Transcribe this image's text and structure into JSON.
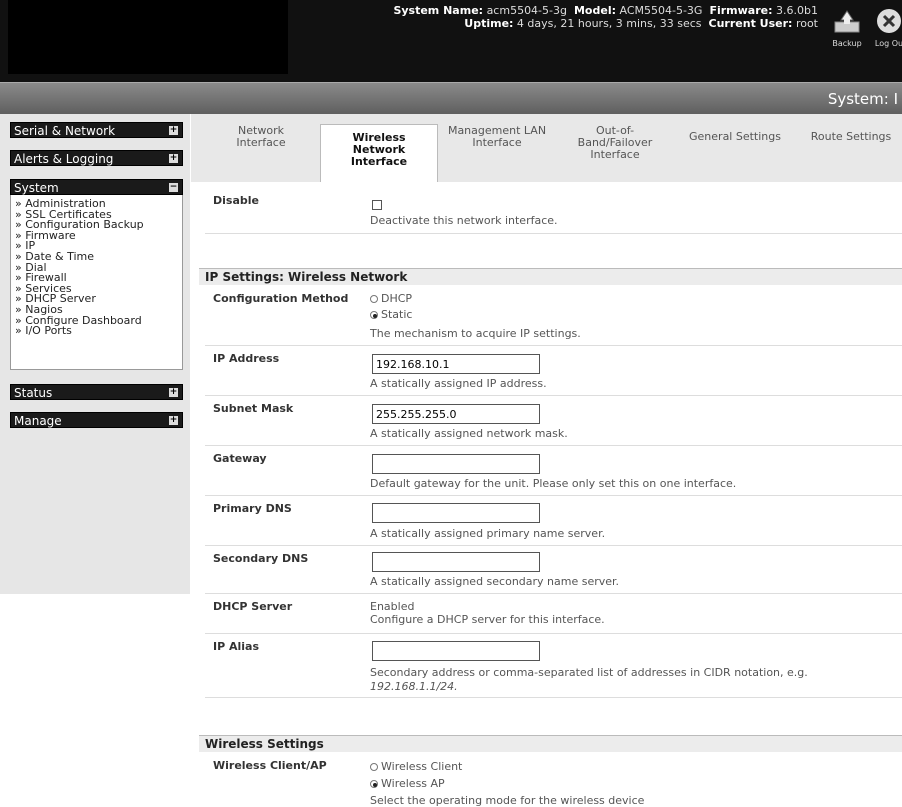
{
  "header": {
    "sys_name_label": "System Name:",
    "sys_name": "acm5504-5-3g",
    "model_label": "Model:",
    "model": "ACM5504-5-3G",
    "firmware_label": "Firmware:",
    "firmware": "3.6.0b1",
    "uptime_label": "Uptime:",
    "uptime": "4 days, 21 hours, 3 mins, 33 secs",
    "user_label": "Current User:",
    "user": "root",
    "backup_label": "Backup",
    "logout_label": "Log Ou"
  },
  "title": "System: I",
  "sidebar": {
    "serial_network": "Serial & Network",
    "alerts_logging": "Alerts & Logging",
    "system": "System",
    "system_items": [
      "» Administration",
      "» SSL Certificates",
      "» Configuration Backup",
      "» Firmware",
      "» IP",
      "» Date & Time",
      "» Dial",
      "» Firewall",
      "» Services",
      "» DHCP Server",
      "» Nagios",
      "» Configure Dashboard",
      "» I/O Ports"
    ],
    "status": "Status",
    "manage": "Manage",
    "plus": "+",
    "minus": "−"
  },
  "tabs": [
    {
      "line1": "Network",
      "line2": "Interface",
      "line3": ""
    },
    {
      "line1": "Wireless",
      "line2": "Network",
      "line3": "Interface"
    },
    {
      "line1": "Management LAN",
      "line2": "Interface",
      "line3": ""
    },
    {
      "line1": "Out-of-",
      "line2": "Band/Failover",
      "line3": "Interface"
    },
    {
      "line1": "General Settings",
      "line2": "",
      "line3": ""
    },
    {
      "line1": "Route Settings",
      "line2": "",
      "line3": ""
    }
  ],
  "form": {
    "disable_label": "Disable",
    "disable_help": "Deactivate this network interface.",
    "ip_section": "IP Settings: Wireless Network",
    "config_label": "Configuration Method",
    "dhcp_option": "DHCP",
    "static_option": "Static",
    "config_help": "The mechanism to acquire IP settings.",
    "ip_label": "IP Address",
    "ip_value": "192.168.10.1",
    "ip_help": "A statically assigned IP address.",
    "mask_label": "Subnet Mask",
    "mask_value": "255.255.255.0",
    "mask_help": "A statically assigned network mask.",
    "gateway_label": "Gateway",
    "gateway_value": "",
    "gateway_help": "Default gateway for the unit. Please only set this on one interface.",
    "dns1_label": "Primary DNS",
    "dns1_value": "",
    "dns1_help": "A statically assigned primary name server.",
    "dns2_label": "Secondary DNS",
    "dns2_value": "",
    "dns2_help": "A statically assigned secondary name server.",
    "dhcp_label": "DHCP Server",
    "dhcp_value": "Enabled",
    "dhcp_help": "Configure a DHCP server for this interface.",
    "alias_label": "IP Alias",
    "alias_value": "",
    "alias_help": "Secondary address or comma-separated list of addresses in CIDR notation, e.g.",
    "alias_example": "192.168.1.1/24.",
    "wireless_section": "Wireless Settings",
    "mode_label": "Wireless Client/AP",
    "client_option": "Wireless Client",
    "ap_option": "Wireless AP",
    "mode_help": "Select the operating mode for the wireless device"
  }
}
